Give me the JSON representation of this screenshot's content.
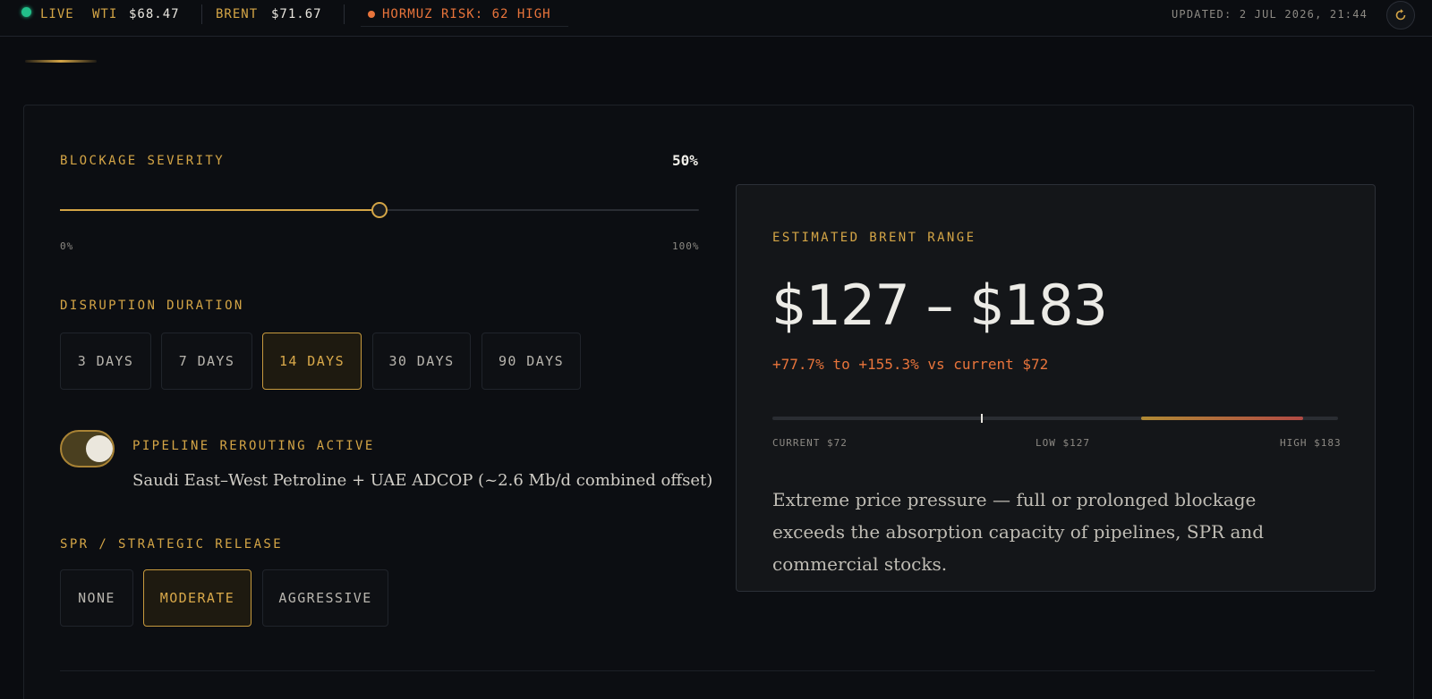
{
  "topbar": {
    "live_label": "LIVE",
    "wti_label": "WTI",
    "wti_value": "$68.47",
    "brent_label": "BRENT",
    "brent_value": "$71.67",
    "risk_label": "HORMUZ RISK: 62 HIGH",
    "updated": "UPDATED: 2 JUL 2026, 21:44",
    "refresh_icon": "refresh-icon"
  },
  "colors": {
    "accent": "#d4a546",
    "live": "#22c08a",
    "risk": "#e8743b",
    "background": "#0a0c10"
  },
  "severity": {
    "label": "BLOCKAGE SEVERITY",
    "value_text": "50%",
    "value": 50,
    "min_label": "0%",
    "max_label": "100%"
  },
  "duration": {
    "label": "DISRUPTION DURATION",
    "options": [
      "3 DAYS",
      "7 DAYS",
      "14 DAYS",
      "30 DAYS",
      "90 DAYS"
    ],
    "selected": "14 DAYS"
  },
  "pipeline": {
    "label": "PIPELINE REROUTING ACTIVE",
    "active": true,
    "description": "Saudi East–West Petroline + UAE ADCOP (~2.6 Mb/d combined offset)"
  },
  "spr": {
    "label": "SPR / STRATEGIC RELEASE",
    "options": [
      "NONE",
      "MODERATE",
      "AGGRESSIVE"
    ],
    "selected": "MODERATE"
  },
  "result": {
    "label": "ESTIMATED BRENT RANGE",
    "range_text": "$127 – $183",
    "change_text": "+77.7% to +155.3% vs current $72",
    "current_label": "CURRENT $72",
    "low_label": "LOW $127",
    "high_label": "HIGH $183",
    "current": 72,
    "low": 127,
    "high": 183,
    "assessment": "Extreme price pressure — full or prolonged blockage exceeds the absorption capacity of pipelines, SPR and commercial stocks."
  }
}
